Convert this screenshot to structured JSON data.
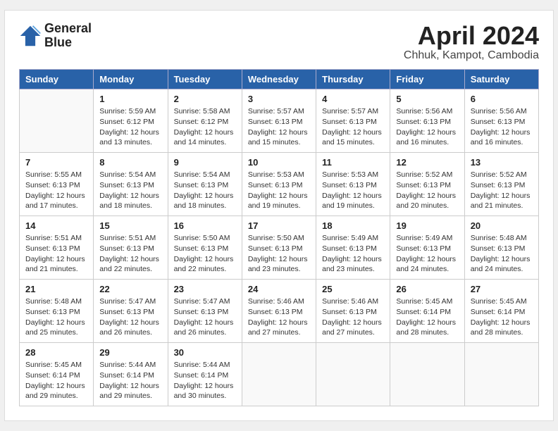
{
  "header": {
    "logo_line1": "General",
    "logo_line2": "Blue",
    "title": "April 2024",
    "subtitle": "Chhuk, Kampot, Cambodia"
  },
  "weekdays": [
    "Sunday",
    "Monday",
    "Tuesday",
    "Wednesday",
    "Thursday",
    "Friday",
    "Saturday"
  ],
  "weeks": [
    [
      {
        "day": "",
        "empty": true
      },
      {
        "day": "1",
        "sunrise": "5:59 AM",
        "sunset": "6:12 PM",
        "daylight": "12 hours and 13 minutes."
      },
      {
        "day": "2",
        "sunrise": "5:58 AM",
        "sunset": "6:12 PM",
        "daylight": "12 hours and 14 minutes."
      },
      {
        "day": "3",
        "sunrise": "5:57 AM",
        "sunset": "6:13 PM",
        "daylight": "12 hours and 15 minutes."
      },
      {
        "day": "4",
        "sunrise": "5:57 AM",
        "sunset": "6:13 PM",
        "daylight": "12 hours and 15 minutes."
      },
      {
        "day": "5",
        "sunrise": "5:56 AM",
        "sunset": "6:13 PM",
        "daylight": "12 hours and 16 minutes."
      },
      {
        "day": "6",
        "sunrise": "5:56 AM",
        "sunset": "6:13 PM",
        "daylight": "12 hours and 16 minutes."
      }
    ],
    [
      {
        "day": "7",
        "sunrise": "5:55 AM",
        "sunset": "6:13 PM",
        "daylight": "12 hours and 17 minutes."
      },
      {
        "day": "8",
        "sunrise": "5:54 AM",
        "sunset": "6:13 PM",
        "daylight": "12 hours and 18 minutes."
      },
      {
        "day": "9",
        "sunrise": "5:54 AM",
        "sunset": "6:13 PM",
        "daylight": "12 hours and 18 minutes."
      },
      {
        "day": "10",
        "sunrise": "5:53 AM",
        "sunset": "6:13 PM",
        "daylight": "12 hours and 19 minutes."
      },
      {
        "day": "11",
        "sunrise": "5:53 AM",
        "sunset": "6:13 PM",
        "daylight": "12 hours and 19 minutes."
      },
      {
        "day": "12",
        "sunrise": "5:52 AM",
        "sunset": "6:13 PM",
        "daylight": "12 hours and 20 minutes."
      },
      {
        "day": "13",
        "sunrise": "5:52 AM",
        "sunset": "6:13 PM",
        "daylight": "12 hours and 21 minutes."
      }
    ],
    [
      {
        "day": "14",
        "sunrise": "5:51 AM",
        "sunset": "6:13 PM",
        "daylight": "12 hours and 21 minutes."
      },
      {
        "day": "15",
        "sunrise": "5:51 AM",
        "sunset": "6:13 PM",
        "daylight": "12 hours and 22 minutes."
      },
      {
        "day": "16",
        "sunrise": "5:50 AM",
        "sunset": "6:13 PM",
        "daylight": "12 hours and 22 minutes."
      },
      {
        "day": "17",
        "sunrise": "5:50 AM",
        "sunset": "6:13 PM",
        "daylight": "12 hours and 23 minutes."
      },
      {
        "day": "18",
        "sunrise": "5:49 AM",
        "sunset": "6:13 PM",
        "daylight": "12 hours and 23 minutes."
      },
      {
        "day": "19",
        "sunrise": "5:49 AM",
        "sunset": "6:13 PM",
        "daylight": "12 hours and 24 minutes."
      },
      {
        "day": "20",
        "sunrise": "5:48 AM",
        "sunset": "6:13 PM",
        "daylight": "12 hours and 24 minutes."
      }
    ],
    [
      {
        "day": "21",
        "sunrise": "5:48 AM",
        "sunset": "6:13 PM",
        "daylight": "12 hours and 25 minutes."
      },
      {
        "day": "22",
        "sunrise": "5:47 AM",
        "sunset": "6:13 PM",
        "daylight": "12 hours and 26 minutes."
      },
      {
        "day": "23",
        "sunrise": "5:47 AM",
        "sunset": "6:13 PM",
        "daylight": "12 hours and 26 minutes."
      },
      {
        "day": "24",
        "sunrise": "5:46 AM",
        "sunset": "6:13 PM",
        "daylight": "12 hours and 27 minutes."
      },
      {
        "day": "25",
        "sunrise": "5:46 AM",
        "sunset": "6:13 PM",
        "daylight": "12 hours and 27 minutes."
      },
      {
        "day": "26",
        "sunrise": "5:45 AM",
        "sunset": "6:14 PM",
        "daylight": "12 hours and 28 minutes."
      },
      {
        "day": "27",
        "sunrise": "5:45 AM",
        "sunset": "6:14 PM",
        "daylight": "12 hours and 28 minutes."
      }
    ],
    [
      {
        "day": "28",
        "sunrise": "5:45 AM",
        "sunset": "6:14 PM",
        "daylight": "12 hours and 29 minutes."
      },
      {
        "day": "29",
        "sunrise": "5:44 AM",
        "sunset": "6:14 PM",
        "daylight": "12 hours and 29 minutes."
      },
      {
        "day": "30",
        "sunrise": "5:44 AM",
        "sunset": "6:14 PM",
        "daylight": "12 hours and 30 minutes."
      },
      {
        "day": "",
        "empty": true
      },
      {
        "day": "",
        "empty": true
      },
      {
        "day": "",
        "empty": true
      },
      {
        "day": "",
        "empty": true
      }
    ]
  ]
}
